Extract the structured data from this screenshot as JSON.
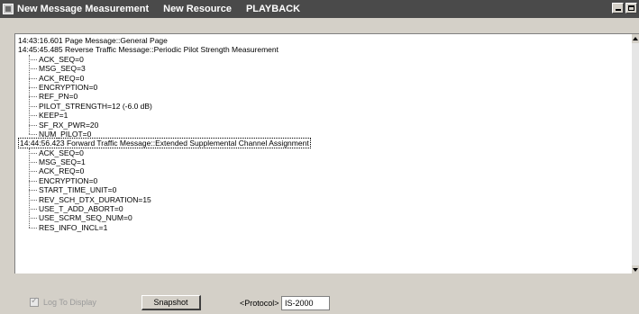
{
  "titlebar": {
    "parts": [
      "New Message Measurement",
      "New Resource",
      "PLAYBACK"
    ]
  },
  "log": {
    "lines": [
      {
        "kind": "top",
        "text": "14:43:16.601   Page Message::General Page"
      },
      {
        "kind": "top",
        "text": "14:45:45.485   Reverse Traffic Message::Periodic Pilot Strength Measurement"
      },
      {
        "kind": "child",
        "text": "ACK_SEQ=0"
      },
      {
        "kind": "child",
        "text": "MSG_SEQ=3"
      },
      {
        "kind": "child",
        "text": "ACK_REQ=0"
      },
      {
        "kind": "child",
        "text": "ENCRYPTION=0"
      },
      {
        "kind": "child",
        "text": "REF_PN=0"
      },
      {
        "kind": "child",
        "text": "PILOT_STRENGTH=12 (-6.0 dB)"
      },
      {
        "kind": "child",
        "text": "KEEP=1"
      },
      {
        "kind": "child",
        "text": "SF_RX_PWR=20"
      },
      {
        "kind": "child",
        "text": "NUM_PILOT=0"
      },
      {
        "kind": "top",
        "text": "14:44:56.423   Forward Traffic Message::Extended Supplemental Channel Assignment",
        "selected": true
      },
      {
        "kind": "child",
        "text": "ACK_SEQ=0"
      },
      {
        "kind": "child",
        "text": "MSG_SEQ=1"
      },
      {
        "kind": "child",
        "text": "ACK_REQ=0"
      },
      {
        "kind": "child",
        "text": "ENCRYPTION=0"
      },
      {
        "kind": "child",
        "text": "START_TIME_UNIT=0"
      },
      {
        "kind": "child",
        "text": "REV_SCH_DTX_DURATION=15"
      },
      {
        "kind": "child",
        "text": "USE_T_ADD_ABORT=0"
      },
      {
        "kind": "child",
        "text": "USE_SCRM_SEQ_NUM=0"
      },
      {
        "kind": "child",
        "text": "RES_INFO_INCL=1"
      }
    ]
  },
  "bottom": {
    "log_to_display": "Log To Display",
    "log_to_display_checked": true,
    "snapshot_label": "Snapshot",
    "protocol_label": "<Protocol>",
    "protocol_value": "IS-2000"
  },
  "colors": {
    "titlebar": "#4a4a4a",
    "window_face": "#d4d0c8",
    "log_background": "#ffffff"
  }
}
